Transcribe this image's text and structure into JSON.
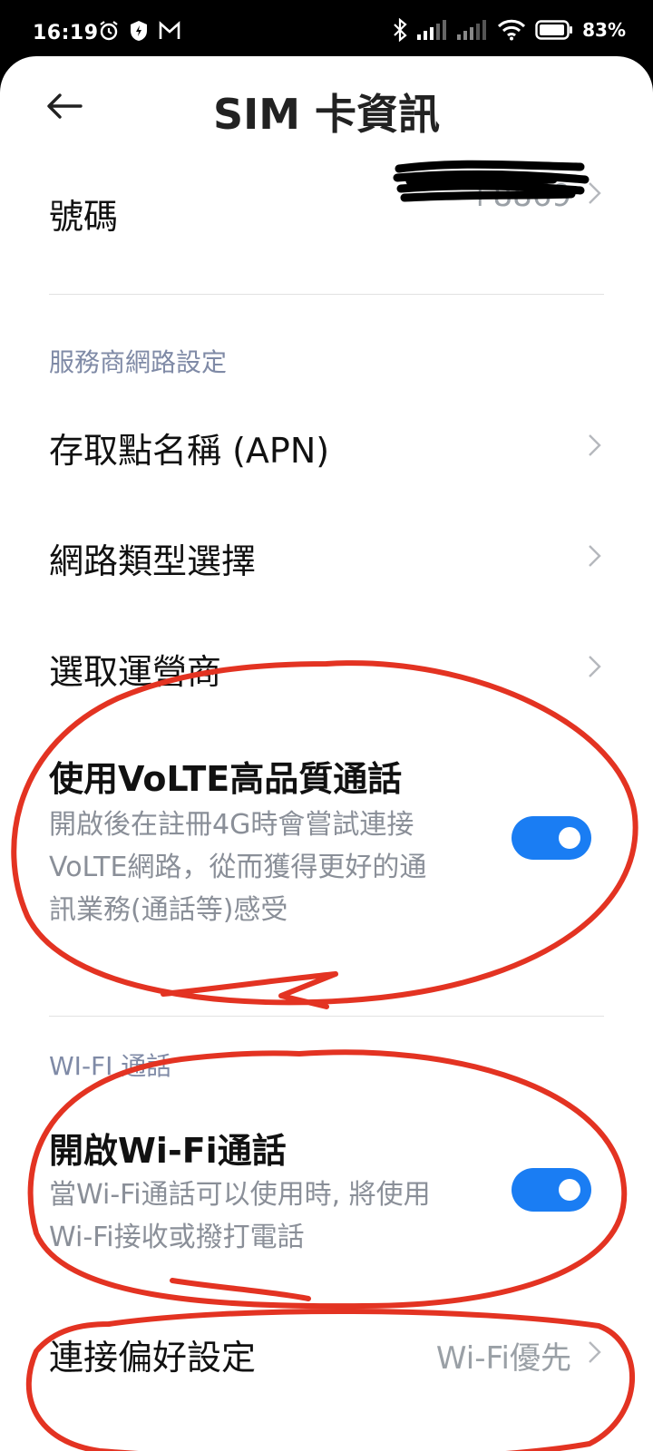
{
  "status_bar": {
    "time": "16:19",
    "battery": "83%",
    "icons": [
      "alarm-icon",
      "shield-icon",
      "m-app-icon",
      "bluetooth-icon",
      "signal-icon",
      "signal-icon",
      "wifi-icon",
      "battery-icon"
    ]
  },
  "header": {
    "title": "SIM 卡資訊",
    "back_icon": "back-arrow-icon"
  },
  "items": {
    "edit_number": {
      "label": "號碼",
      "value": "+8869"
    },
    "section_carrier": "服務商網路設定",
    "apn": {
      "label": "存取點名稱 (APN)"
    },
    "network_type": {
      "label": "網路類型選擇"
    },
    "carrier": {
      "label": "選取運營商"
    },
    "volte": {
      "label": "使用VoLTE高品質通話",
      "desc_lines": [
        "開啟後在註冊4G時會嘗試連接",
        "VoLTE網路，從而獲得更好的通",
        "訊業務(通話等)感受"
      ],
      "toggle_on": true
    },
    "section_wifi": "WI-FI 通話",
    "wifi_calling": {
      "label": "開啟Wi-Fi通話",
      "desc_lines": [
        "當Wi-Fi通話可以使用時, 將使用",
        "Wi-Fi接收或撥打電話"
      ],
      "toggle_on": true
    },
    "connection_pref": {
      "label": "連接偏好設定",
      "value": "Wi-Fi優先"
    }
  },
  "colors": {
    "toggle_on": "#1a7df3",
    "annotation": "#e33322",
    "section_text": "#7f8aa6"
  }
}
